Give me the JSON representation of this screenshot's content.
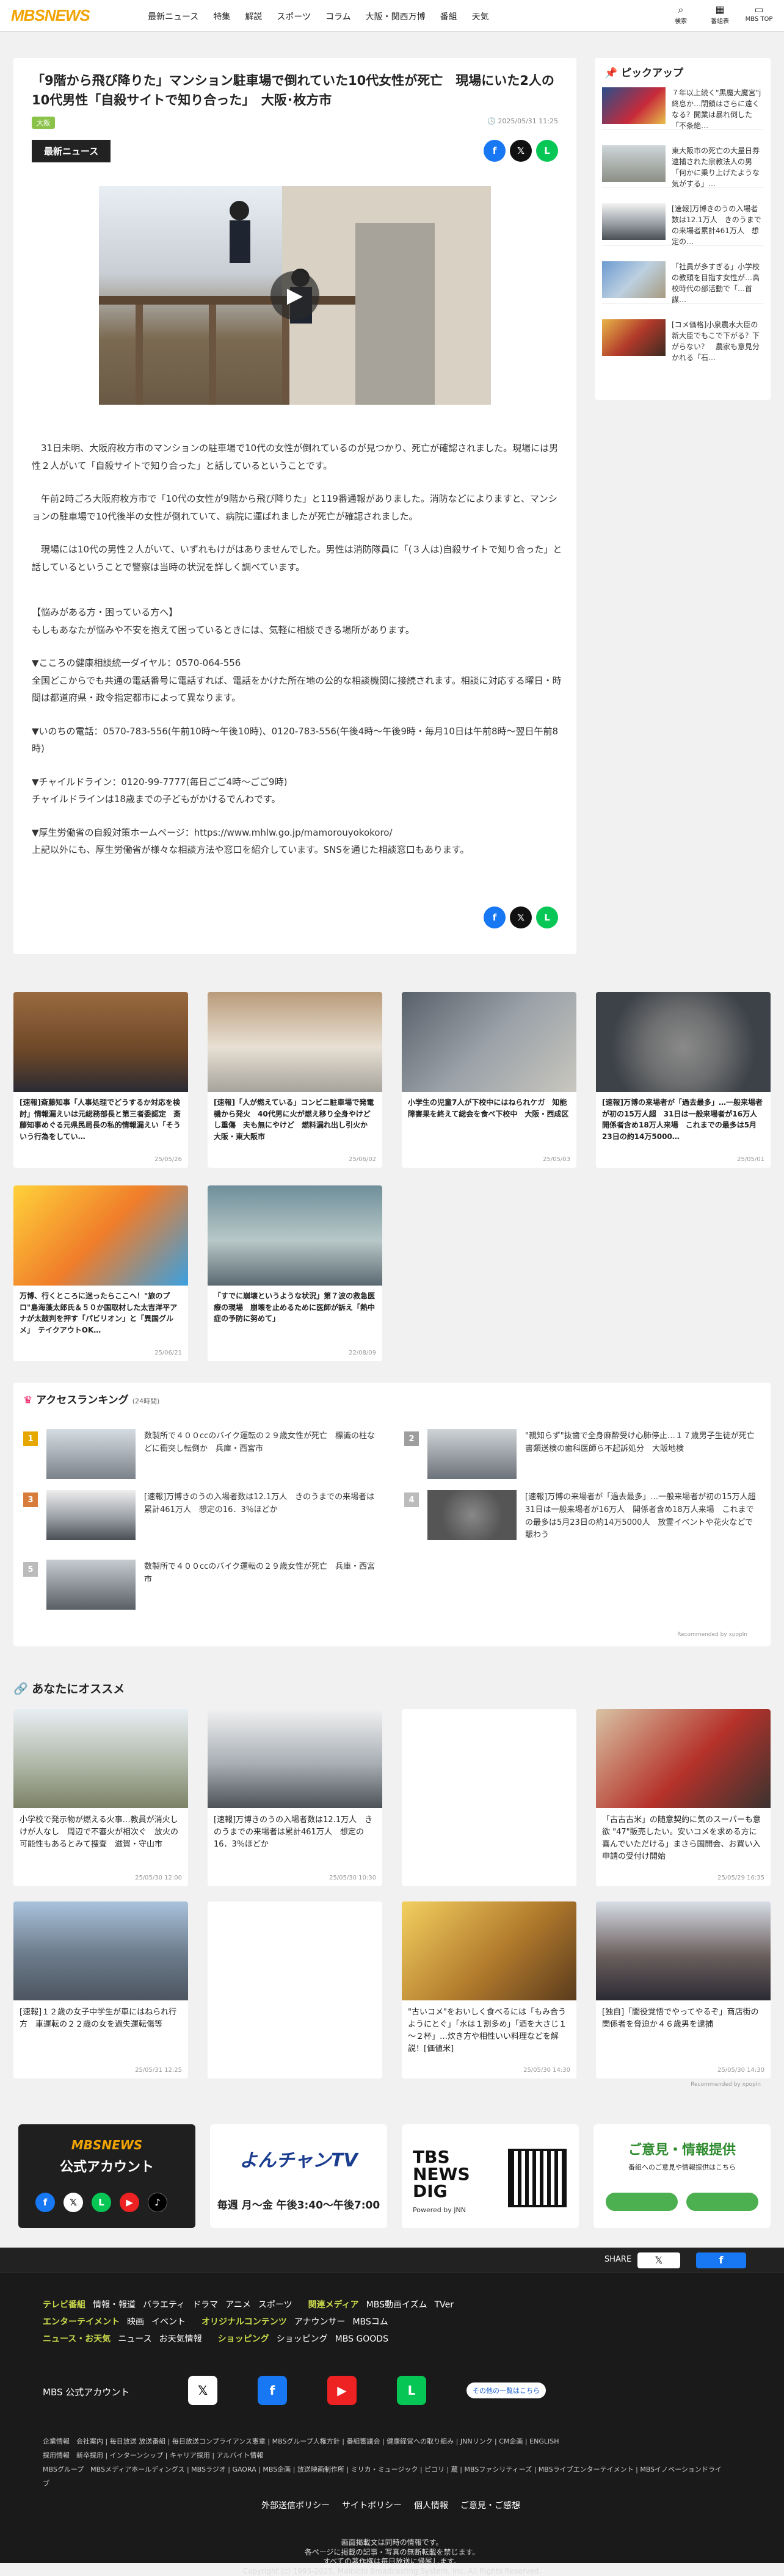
{
  "header": {
    "logo": "MBSNEWS",
    "nav": [
      "最新ニュース",
      "特集",
      "解説",
      "スポーツ",
      "コラム",
      "大阪・関西万博",
      "番組",
      "天気"
    ],
    "icons": [
      {
        "label": "検索",
        "icon": "search-icon"
      },
      {
        "label": "番組表",
        "icon": "calendar-icon"
      },
      {
        "label": "MBS TOP",
        "icon": "tv-icon"
      }
    ]
  },
  "article": {
    "title": "「9階から飛び降りた」マンション駐車場で倒れていた10代女性が死亡　現場にいた2人の10代男性「自殺サイトで知り合った」　大阪･枚方市",
    "tag": "大阪",
    "date": "2025/05/31 11:25",
    "badge": "最新ニュース",
    "paragraphs": [
      "31日未明、大阪府枚方市のマンションの駐車場で10代の女性が倒れているのが見つかり、死亡が確認されました。現場には男性２人がいて「自殺サイトで知り合った」と話しているということです。",
      "午前2時ごろ大阪府枚方市で「10代の女性が9階から飛び降りた」と119番通報がありました。消防などによりますと、マンションの駐車場で10代後半の女性が倒れていて、病院に運ばれましたが死亡が確認されました。",
      "現場には10代の男性２人がいて、いずれもけがはありませんでした。男性は消防隊員に「(３人は)自殺サイトで知り合った」と話しているということで警察は当時の状況を詳しく調べています。",
      "【悩みがある方・困っている方へ】\nもしもあなたが悩みや不安を抱えて困っているときには、気軽に相談できる場所があります。",
      "▼こころの健康相談統一ダイヤル：0570-064-556\n全国どこからでも共通の電話番号に電話すれば、電話をかけた所在地の公的な相談機関に接続されます。相談に対応する曜日・時間は都道府県・政令指定都市によって異なります。",
      "▼いのちの電話：0570-783-556(午前10時～午後10時)、0120-783-556(午後4時～午後9時・毎月10日は午前8時～翌日午前8時)",
      "▼チャイルドライン：0120-99-7777(毎日ごご4時～ごご9時)\nチャイルドラインは18歳までの子どもがかけるでんわです。",
      "▼厚生労働省の自殺対策ホームページ：https://www.mhlw.go.jp/mamorouyokokoro/\n上記以外にも、厚生労働省が様々な相談方法や窓口を紹介しています。SNSを通じた相談窓口もあります。"
    ]
  },
  "pickup": {
    "title": "ピックアップ",
    "items": [
      "７年以上続く\"黒魔大魔宮\"j 終息か…閉鎖はさらに遠くなる？開業は暴れ倒した「不条絶…",
      "東大阪市の死亡の大量日券　逮捕された宗教法人の男「何かに乗り上げたような気がする」…",
      "[速報]万博きのうの入場者数は12.1万人　きのうまでの来場者累計461万人　想定の…",
      "「社員が多すぎる」小学校の教頭を目指す女性が…高校時代の部活動で「…首謀…",
      "[コメ価格]小泉農水大臣の新大臣でもこで下がる？下がらない？　農家も意見分かれる「石…"
    ]
  },
  "cards1": [
    {
      "title": "[速報]斎藤知事「人事処理でどうするか対応を検討」情報漏えいは元総務部長と第三者委認定　斎藤知事めぐる元県民局長の私的情報漏えい「そういう行為をしてい…",
      "date": "25/05/26"
    },
    {
      "title": "[速報]「人が燃えている」コンビニ駐車場で発電機から発火　40代男に火が燃え移り全身やけどし重傷　夫も無にやけど　燃料漏れ出し引火か　大阪・東大阪市",
      "date": "25/06/02"
    },
    {
      "title": "小学生の児童7人が下校中にはねられケガ　知能障害果を終えて総会を食べ下校中　大阪・西成区",
      "date": "25/05/03"
    },
    {
      "title": "[速報]万博の来場者が「過去最多」…一般来場者が初の15万人超　31日は一般来場者が16万人　開係者含め18万人来場　これまでの最多は5月23日の約14万5000…",
      "date": "25/05/01"
    }
  ],
  "cards2": [
    {
      "title": "万博、行くところに迷ったらここへ！\"旅のプロ\"島海藻太郎氏＆５０か国取材した太吉洋平アナが太鼓判を押す「パビリオン」と「異国グルメ」　テイクアウトOK…",
      "date": "25/06/21"
    },
    {
      "title": "「すでに崩壊というような状況」第７波の救急医療の現場　崩壊を止めるために医師が訴え「熱中症の予防に努めて」",
      "date": "22/08/09"
    }
  ],
  "ranking": {
    "title": "アクセスランキング",
    "subtitle": "(24時間)",
    "items": [
      "数製所で４００ccのバイク運転の２９歳女性が死亡　標識の柱などに衝突し転倒か　兵庫・西宮市",
      "\"親知らず\"抜歯で全身麻酔受け心肺停止…１７歳男子生徒が死亡　書類送検の歯科医師ら不起訴処分　大阪地検",
      "[速報]万博きのうの入場者数は12.1万人　きのうまでの来場者は累計461万人　想定の16．3％ほどか",
      "[速報]万博の来場者が「過去最多」…一般来場者が初の15万人超　31日は一般来場者が16万人　開係者含め18万人来場　これまでの最多は5月23日の約14万5000人　放霊イベントや花火などで賑わう",
      "数製所で４００ccのバイク運転の２９歳女性が死亡　兵庫・西宮市"
    ],
    "colors": [
      "#e6a700",
      "#9e9e9e",
      "#d87c3c",
      "#bbb",
      "#bbb"
    ],
    "recommend": "Recommended by ⅹpopln"
  },
  "osusume": {
    "title": "あなたにオススメ",
    "items": [
      {
        "title": "小学校で発示物が燃える火事…教員が消火し けが人なし　周辺で不審火が相次ぐ　放火の可能性もあるとみて捜査　滋賀・守山市",
        "date": "25/05/30 12:00"
      },
      {
        "title": "[速報]万博きのうの入場者数は12.1万人　きのうまでの来場者は累計461万人　想定の16．3％ほどか",
        "date": "25/05/30 10:30"
      },
      {
        "title": "",
        "date": ""
      },
      {
        "title": "「古古古米」の随意契約に気のスーパーも意欲 \"47\"販売したい。安いコメを求める方に喜んでいただける」まさら国開会、お買い入申請の受付け開始",
        "date": "25/05/29 16:35"
      },
      {
        "title": "[速報]１２歳の女子中学生が車にはねられ行方　車運転の２２歳の女を過失運転傷等",
        "date": "25/05/31 12:25"
      },
      {
        "title": "",
        "date": ""
      },
      {
        "title": "\"古いコメ\"をおいしく食べるには「もみ合うようにとぐ」「水は１割多め」「酒を大さじ１～２杯」…炊き方や相性いい料理などを解説！[価値米]",
        "date": "25/05/30 14:30"
      },
      {
        "title": "[独自]「闇役覚悟でやってやるぞ」商店街の関係者を脅迫か４６歳男を逮捕",
        "date": "25/05/30 14:30"
      }
    ],
    "recommend": "Recommended by ⅹpopln"
  },
  "banners": [
    {
      "l1": "MBSNEWS",
      "l2": "公式アカウント"
    },
    {
      "l1": "よんチャンTV",
      "l2": "毎週 月～金 午後3:40～午後7:00"
    },
    {
      "l1": "TBS NEWS DIG",
      "l2": "Powered by JNN"
    },
    {
      "l1": "ご意見・情報提供",
      "l2": "番組へのご意見や情報提供はこちら"
    }
  ],
  "footer": {
    "share": "SHARE",
    "rows": [
      {
        "head": "テレビ番組",
        "items": [
          "情報・報道",
          "バラエティ",
          "ドラマ",
          "アニメ",
          "スポーツ"
        ],
        "head2": "関連メディア",
        "items2": [
          "MBS動画イズム",
          "TVer"
        ]
      },
      {
        "head": "エンターテイメント",
        "items": [
          "映画",
          "イベント"
        ],
        "head2": "オリジナルコンテンツ",
        "items2": [
          "アナウンサー",
          "MBSコム"
        ]
      },
      {
        "head": "ニュース・お天気",
        "items": [
          "ニュース",
          "お天気情報"
        ],
        "head2": "ショッピング",
        "items2": [
          "ショッピング",
          "MBS GOODS"
        ]
      }
    ],
    "official": "MBS 公式アカウント",
    "all_btn": "その他の一覧はこちら",
    "small1": "企業情報　会社案内 | 毎日放送 放送番組 | 毎日放送コンプライアンス憲章 | MBSグループ人権方針 | 番組審議会 | 健康経営への取り組み | JNNリンク | CM企画 | ENGLISH",
    "small2": "採用情報　新卒採用 | インターンシップ | キャリア採用 | アルバイト情報",
    "small3": "MBSグループ　MBSメディアホールディングス | MBSラジオ | GAORA | MBS企画 | 放送映画制作所 | ミリカ・ミュージック | ピコリ | 蔵 | MBSファシリティーズ | MBSライブエンターテイメント | MBSイノベーションドライブ",
    "policies": [
      "外部送信ポリシー",
      "サイトポリシー",
      "個人情報",
      "ご意見・ご感想"
    ],
    "copy1": "画面掲載文は同時の情報です。",
    "copy2": "各ページに掲載の記事・写真の無断転載を禁じます。",
    "copy3": "すべての著作権は毎日放送に帰属します。",
    "copy4": "Copyright (c) 1995-2025, Mainichi Broadcasting System, Inc. All Rights Reserved."
  }
}
